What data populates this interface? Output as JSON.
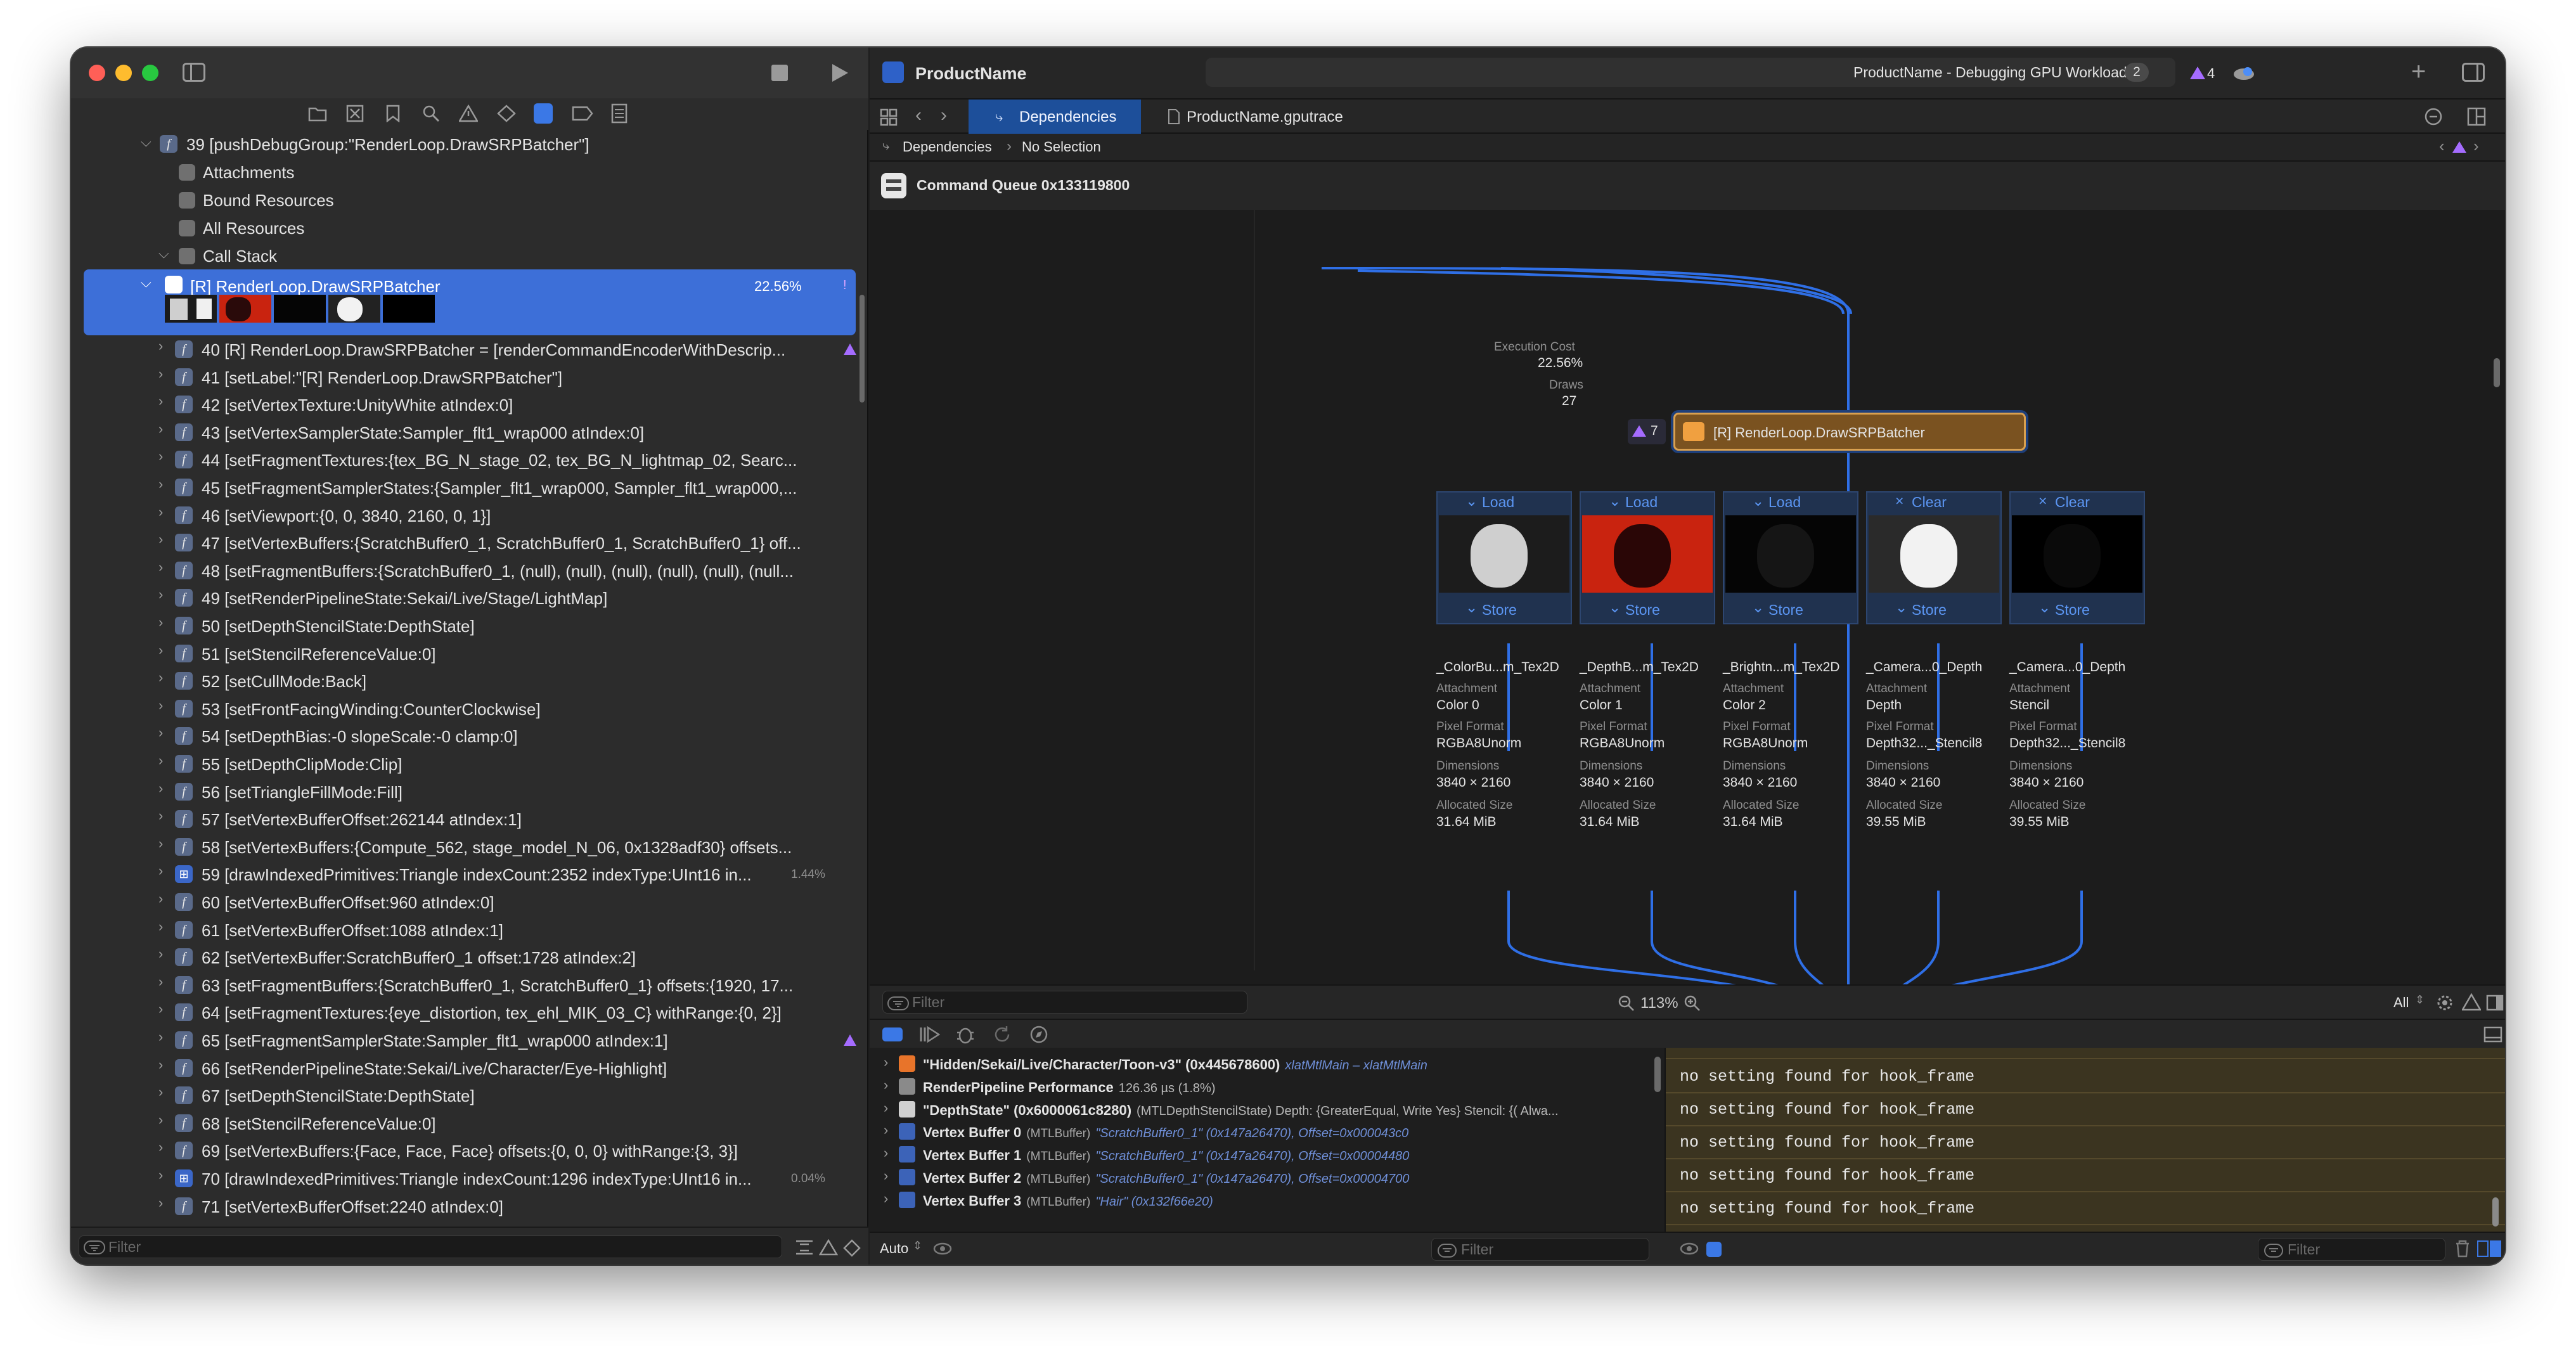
{
  "sidebar": {
    "header_row": "39 [pushDebugGroup:\"RenderLoop.DrawSRPBatcher\"]",
    "children": [
      "Attachments",
      "Bound Resources",
      "All Resources",
      "Call Stack"
    ],
    "selected": {
      "label": "[R] RenderLoop.DrawSRPBatcher",
      "percent": "22.56%"
    },
    "rows": [
      {
        "text": "40 [R] RenderLoop.DrawSRPBatcher = [renderCommandEncoderWithDescrip...",
        "badge": "warning"
      },
      {
        "text": "41 [setLabel:\"[R] RenderLoop.DrawSRPBatcher\"]"
      },
      {
        "text": "42 [setVertexTexture:UnityWhite atIndex:0]"
      },
      {
        "text": "43 [setVertexSamplerState:Sampler_flt1_wrap000 atIndex:0]"
      },
      {
        "text": "44 [setFragmentTextures:{tex_BG_N_stage_02, tex_BG_N_lightmap_02, Searc..."
      },
      {
        "text": "45 [setFragmentSamplerStates:{Sampler_flt1_wrap000, Sampler_flt1_wrap000,..."
      },
      {
        "text": "46 [setViewport:{0, 0, 3840, 2160, 0, 1}]"
      },
      {
        "text": "47 [setVertexBuffers:{ScratchBuffer0_1, ScratchBuffer0_1, ScratchBuffer0_1} off..."
      },
      {
        "text": "48 [setFragmentBuffers:{ScratchBuffer0_1, (null), (null), (null), (null), (null), (null..."
      },
      {
        "text": "49 [setRenderPipelineState:Sekai/Live/Stage/LightMap]"
      },
      {
        "text": "50 [setDepthStencilState:DepthState]"
      },
      {
        "text": "51 [setStencilReferenceValue:0]"
      },
      {
        "text": "52 [setCullMode:Back]"
      },
      {
        "text": "53 [setFrontFacingWinding:CounterClockwise]"
      },
      {
        "text": "54 [setDepthBias:-0 slopeScale:-0 clamp:0]"
      },
      {
        "text": "55 [setDepthClipMode:Clip]"
      },
      {
        "text": "56 [setTriangleFillMode:Fill]"
      },
      {
        "text": "57 [setVertexBufferOffset:262144 atIndex:1]"
      },
      {
        "text": "58 [setVertexBuffers:{Compute_562, stage_model_N_06, 0x1328adf30} offsets..."
      },
      {
        "text": "59 [drawIndexedPrimitives:Triangle indexCount:2352 indexType:UInt16 in...",
        "percent": "1.44%",
        "draw": true
      },
      {
        "text": "60 [setVertexBufferOffset:960 atIndex:0]"
      },
      {
        "text": "61 [setVertexBufferOffset:1088 atIndex:1]"
      },
      {
        "text": "62 [setVertexBuffer:ScratchBuffer0_1 offset:1728 atIndex:2]"
      },
      {
        "text": "63 [setFragmentBuffers:{ScratchBuffer0_1, ScratchBuffer0_1} offsets:{1920, 17..."
      },
      {
        "text": "64 [setFragmentTextures:{eye_distortion, tex_ehl_MIK_03_C} withRange:{0, 2}]"
      },
      {
        "text": "65 [setFragmentSamplerState:Sampler_flt1_wrap000 atIndex:1]",
        "badge": "warning"
      },
      {
        "text": "66 [setRenderPipelineState:Sekai/Live/Character/Eye-Highlight]"
      },
      {
        "text": "67 [setDepthStencilState:DepthState]"
      },
      {
        "text": "68 [setStencilReferenceValue:0]"
      },
      {
        "text": "69 [setVertexBuffers:{Face, Face, Face} offsets:{0, 0, 0} withRange:{3, 3}]"
      },
      {
        "text": "70 [drawIndexedPrimitives:Triangle indexCount:1296 indexType:UInt16 in...",
        "percent": "0.04%",
        "draw": true
      },
      {
        "text": "71 [setVertexBufferOffset:2240 atIndex:0]"
      }
    ],
    "filter_placeholder": "Filter"
  },
  "window": {
    "app_name": "ProductName",
    "status": "ProductName - Debugging GPU Workload",
    "status_count": "2",
    "issue_count": "4"
  },
  "tabs": [
    {
      "label": "Dependencies",
      "active": true
    },
    {
      "label": "ProductName.gputrace",
      "active": false
    }
  ],
  "jump_bar": [
    "Dependencies",
    "No Selection"
  ],
  "command_queue": "Command Queue 0x133119800",
  "encoder": {
    "execution_cost_label": "Execution Cost",
    "execution_cost": "22.56%",
    "draws_label": "Draws",
    "draws": "27",
    "warnings": "7",
    "name": "[R] RenderLoop.DrawSRPBatcher"
  },
  "attachments": [
    {
      "load": "Load",
      "store": "Store",
      "name": "_ColorBu...m_Tex2D",
      "attachment": "Color 0",
      "format": "RGBA8Unorm",
      "dimensions": "3840 × 2160",
      "size": "31.64 MiB"
    },
    {
      "load": "Load",
      "store": "Store",
      "name": "_DepthB...m_Tex2D",
      "attachment": "Color 1",
      "format": "RGBA8Unorm",
      "dimensions": "3840 × 2160",
      "size": "31.64 MiB"
    },
    {
      "load": "Load",
      "store": "Store",
      "name": "_Brightn...m_Tex2D",
      "attachment": "Color 2",
      "format": "RGBA8Unorm",
      "dimensions": "3840 × 2160",
      "size": "31.64 MiB"
    },
    {
      "load": "Clear",
      "store": "Store",
      "name": "_Camera...0_Depth",
      "attachment": "Depth",
      "format": "Depth32..._Stencil8",
      "dimensions": "3840 × 2160",
      "size": "39.55 MiB"
    },
    {
      "load": "Clear",
      "store": "Store",
      "name": "_Camera...0_Depth",
      "attachment": "Stencil",
      "format": "Depth32..._Stencil8",
      "dimensions": "3840 × 2160",
      "size": "39.55 MiB"
    }
  ],
  "prop_labels": {
    "attachment": "Attachment",
    "format": "Pixel Format",
    "dimensions": "Dimensions",
    "size": "Allocated Size"
  },
  "canvas_filter": {
    "placeholder": "Filter",
    "zoom": "113%",
    "scope": "All"
  },
  "variables": [
    {
      "name": "\"Hidden/Sekai/Live/Character/Toon-v3\" (0x445678600)",
      "detail": "xlatMtlMain – xlatMtlMain",
      "icon": "orange"
    },
    {
      "name": "RenderPipeline Performance",
      "detail": "126.36 µs (1.8%)",
      "icon": "gray"
    },
    {
      "name": "\"DepthState\" (0x6000061c8280)",
      "detail": "(MTLDepthStencilState) Depth: {GreaterEqual, Write Yes} Stencil: {( Alwa...",
      "icon": "light"
    },
    {
      "name": "Vertex Buffer 0",
      "type": "(MTLBuffer)",
      "detail": "\"ScratchBuffer0_1\" (0x147a26470), Offset=0x000043c0",
      "icon": "grid"
    },
    {
      "name": "Vertex Buffer 1",
      "type": "(MTLBuffer)",
      "detail": "\"ScratchBuffer0_1\" (0x147a26470), Offset=0x00004480",
      "icon": "grid"
    },
    {
      "name": "Vertex Buffer 2",
      "type": "(MTLBuffer)",
      "detail": "\"ScratchBuffer0_1\" (0x147a26470), Offset=0x00004700",
      "icon": "grid"
    },
    {
      "name": "Vertex Buffer 3",
      "type": "(MTLBuffer)",
      "detail": "\"Hair\" (0x132f66e20)",
      "icon": "grid"
    }
  ],
  "console_lines": [
    "no setting found for hook_frame",
    "no setting found for hook_frame",
    "no setting found for hook_frame",
    "no setting found for hook_frame",
    "no setting found for hook_frame"
  ],
  "bottom": {
    "auto_label": "Auto",
    "vars_filter": "Filter",
    "console_filter": "Filter"
  },
  "colors": {
    "accent": "#3d6fd8",
    "encoder": "#7a5220",
    "link": "#3b78e6",
    "console_bg": "#3b3420"
  }
}
